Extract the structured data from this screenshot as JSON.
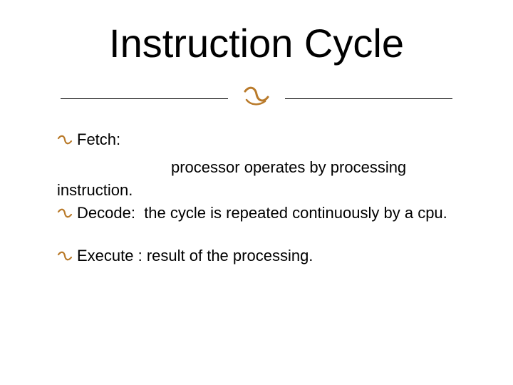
{
  "title": "Instruction Cycle",
  "glyph": "།",
  "bullet": "།",
  "items": {
    "fetch_label": "Fetch:",
    "fetch_body_line1": "processor operates by processing",
    "fetch_body_line2": "instruction.",
    "decode_label": "Decode:",
    "decode_body": "the cycle is repeated continuously by a cpu.",
    "execute_label": "Execute :",
    "execute_body": "result of the processing."
  }
}
